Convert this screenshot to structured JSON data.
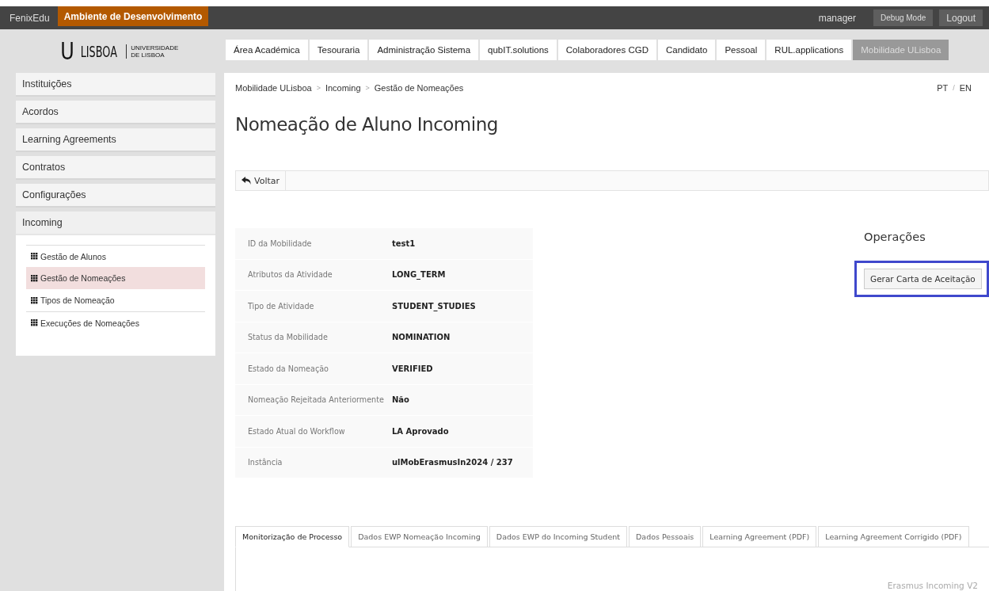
{
  "topbar": {
    "app": "FenixEdu",
    "environment": "Ambiente de Desenvolvimento",
    "user": "manager",
    "buttons": [
      "Debug Mode",
      "Logout"
    ]
  },
  "logo": {
    "mark": "U",
    "name": "LISBOA",
    "sub": [
      "UNIVERSIDADE",
      "DE LISBOA"
    ]
  },
  "modules": [
    {
      "label": "Área Académica",
      "selected": false
    },
    {
      "label": "Tesouraria",
      "selected": false
    },
    {
      "label": "Administração Sistema",
      "selected": false
    },
    {
      "label": "qubIT.solutions",
      "selected": false
    },
    {
      "label": "Colaboradores CGD",
      "selected": false
    },
    {
      "label": "Candidato",
      "selected": false
    },
    {
      "label": "Pessoal",
      "selected": false
    },
    {
      "label": "RUL.applications",
      "selected": false
    },
    {
      "label": "Mobilidade ULisboa",
      "selected": true
    }
  ],
  "sidebar": {
    "items": [
      {
        "label": "Instituições",
        "expanded": false
      },
      {
        "label": "Acordos",
        "expanded": false
      },
      {
        "label": "Learning Agreements",
        "expanded": false
      },
      {
        "label": "Contratos",
        "expanded": false
      },
      {
        "label": "Configurações",
        "expanded": false
      },
      {
        "label": "Incoming",
        "expanded": true,
        "children": [
          {
            "label": "Gestão de Alunos",
            "selected": false
          },
          {
            "label": "Gestão de Nomeações",
            "selected": true
          },
          {
            "label": "Tipos de Nomeação",
            "selected": false
          },
          {
            "label": "Execuções de Nomeações",
            "selected": false
          }
        ]
      }
    ]
  },
  "breadcrumb": [
    "Mobilidade ULisboa",
    "Incoming",
    "Gestão de Nomeações"
  ],
  "breadcrumb_separator": ">",
  "languages": [
    "PT",
    "EN"
  ],
  "language_separator": "/",
  "title": "Nomeação de Aluno Incoming",
  "toolbar": {
    "back": "Voltar"
  },
  "details": [
    {
      "label": "ID da Mobilidade",
      "value": "test1"
    },
    {
      "label": "Atributos da Atividade",
      "value": "LONG_TERM"
    },
    {
      "label": "Tipo de Atividade",
      "value": "STUDENT_STUDIES"
    },
    {
      "label": "Status da Mobilidade",
      "value": "NOMINATION"
    },
    {
      "label": "Estado da Nomeação",
      "value": "VERIFIED"
    },
    {
      "label": "Nomeação Rejeitada Anteriormente",
      "value": "Não"
    },
    {
      "label": "Estado Atual do Workflow",
      "value": "LA Aprovado"
    },
    {
      "label": "Instância",
      "value": "ulMobErasmusIn2024 / 237"
    }
  ],
  "operations": {
    "title": "Operações",
    "buttons": [
      {
        "label": "Gerar Carta de Aceitação",
        "highlighted": true
      }
    ]
  },
  "tabs": [
    {
      "label": "Monitorização de Processo",
      "selected": true
    },
    {
      "label": "Dados EWP Nomeação Incoming",
      "selected": false
    },
    {
      "label": "Dados EWP do Incoming Student",
      "selected": false
    },
    {
      "label": "Dados Pessoais",
      "selected": false
    },
    {
      "label": "Learning Agreement (PDF)",
      "selected": false
    },
    {
      "label": "Learning Agreement Corrigido (PDF)",
      "selected": false
    }
  ],
  "footer": "Erasmus Incoming V2"
}
